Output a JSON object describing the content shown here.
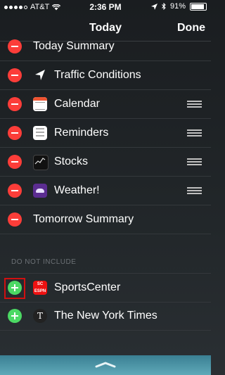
{
  "status_bar": {
    "carrier": "AT&T",
    "time": "2:36 PM",
    "battery": "91%",
    "battery_fraction": 0.91
  },
  "nav": {
    "title": "Today",
    "done": "Done"
  },
  "included": [
    {
      "label": "Today Summary"
    },
    {
      "label": "Traffic Conditions"
    },
    {
      "label": "Calendar"
    },
    {
      "label": "Reminders"
    },
    {
      "label": "Stocks"
    },
    {
      "label": "Weather!"
    },
    {
      "label": "Tomorrow Summary"
    }
  ],
  "section_header": "DO NOT INCLUDE",
  "excluded": [
    {
      "label": "SportsCenter",
      "icon_text": "SC ESPN"
    },
    {
      "label": "The New York Times",
      "icon_text": "T"
    }
  ],
  "colors": {
    "remove": "#fc3d39",
    "add": "#4cd964",
    "highlight": "#d01010"
  }
}
